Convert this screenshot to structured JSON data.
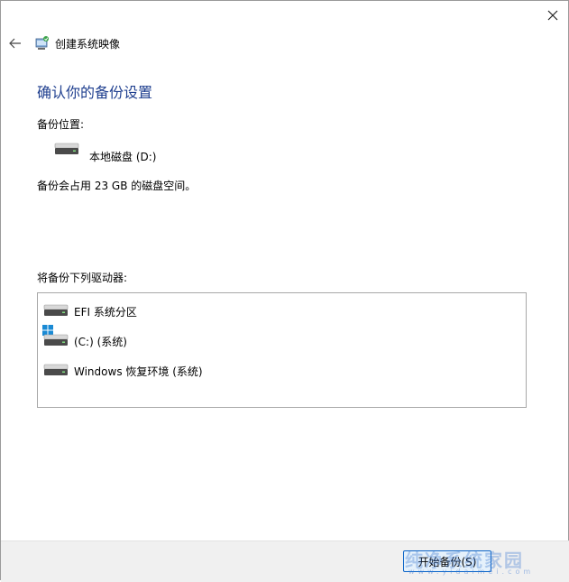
{
  "window": {
    "title": "创建系统映像",
    "close_icon": "close-icon",
    "back_icon": "back-arrow-icon"
  },
  "content": {
    "heading": "确认你的备份设置",
    "backup_location_label": "备份位置:",
    "backup_location_drive": "本地磁盘 (D:)",
    "space_note": "备份会占用 23 GB 的磁盘空间。",
    "drives_label": "将备份下列驱动器:",
    "drives": [
      {
        "label": "EFI 系统分区",
        "icon": "drive-icon",
        "windows_badge": false
      },
      {
        "label": "(C:) (系统)",
        "icon": "drive-icon",
        "windows_badge": true
      },
      {
        "label": "Windows 恢复环境 (系统)",
        "icon": "drive-icon",
        "windows_badge": false
      }
    ]
  },
  "footer": {
    "start_button_label": "开始备份(S)"
  },
  "watermark": {
    "text": "纯净系统家园",
    "sub": "www.yidaimei.com"
  },
  "colors": {
    "heading": "#1f3f8f",
    "accent": "#0a64c8",
    "footer_bg": "#f0f0f0"
  }
}
